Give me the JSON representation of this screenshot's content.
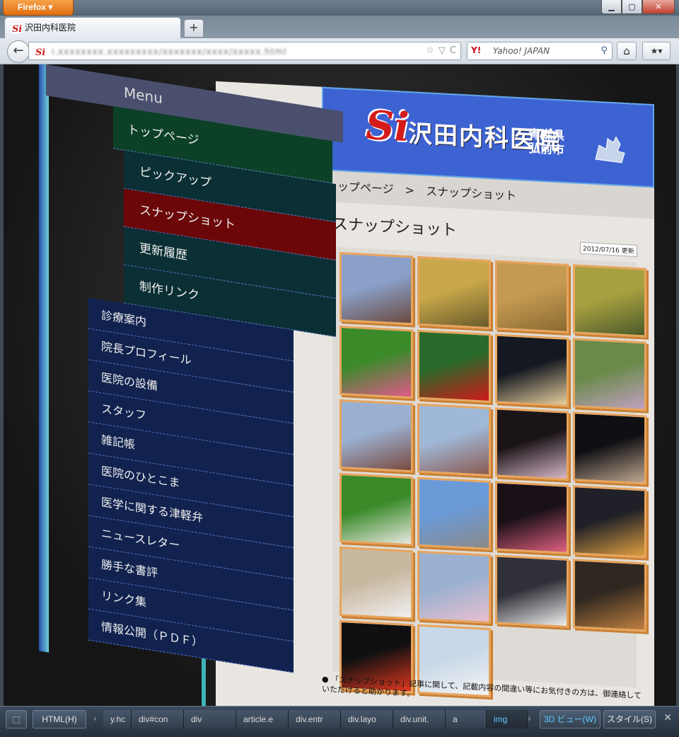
{
  "window": {
    "app_button": "Firefox",
    "controls": {
      "minimize": "▁",
      "maximize": "▢",
      "close": "✕"
    }
  },
  "tab": {
    "title": "沢田内科医院",
    "new_tab": "+"
  },
  "nav": {
    "back": "←",
    "url": "i.xxxxxxxx.xxxxxxxxx/xxxxxxx/xxxx/xxxxx.html",
    "url_icons": {
      "star": "☆",
      "dropdown": "▽",
      "reload": "C"
    },
    "search_engine": "Y!",
    "search_placeholder": "Yahoo! JAPAN",
    "search_icon": "⚲",
    "home": "⌂",
    "bookmarks": "★▾"
  },
  "site": {
    "logo_si": "Si",
    "logo_name": "沢田内科医院",
    "logo_area_line1": "青森県",
    "logo_area_line2": "弘前市",
    "breadcrumb": "トップページ　>　スナップショット",
    "page_title": "スナップショット",
    "updated": "2012/07/16 更新",
    "note": "● 「スナップショット」記事に関して、記載内容の間違い等にお気付きの方は、御連絡していただけると助かります。"
  },
  "menu": {
    "header": "Menu",
    "top": "トップページ",
    "sub_items": [
      {
        "label": "ピックアップ"
      },
      {
        "label": "スナップショット",
        "active": true
      },
      {
        "label": "更新履歴"
      },
      {
        "label": "制作リンク"
      }
    ],
    "items": [
      {
        "label": "診療案内"
      },
      {
        "label": "院長プロフィール"
      },
      {
        "label": "医院の設備"
      },
      {
        "label": "スタッフ"
      },
      {
        "label": "雑記帳"
      },
      {
        "label": "医院のひとこま"
      },
      {
        "label": "医学に関する津軽弁"
      },
      {
        "label": "ニュースレター"
      },
      {
        "label": "勝手な書評"
      },
      {
        "label": "リンク集"
      },
      {
        "label": "情報公開（ＰＤＦ）"
      }
    ]
  },
  "thumbnails": [
    {
      "kind": "building",
      "c1": "#8aa0c8",
      "c2": "#6a4a40"
    },
    {
      "kind": "rice-art",
      "c1": "#c8a84a",
      "c2": "#6a5a2a"
    },
    {
      "kind": "rice-art",
      "c1": "#c49a52",
      "c2": "#8a6a30"
    },
    {
      "kind": "rice-art",
      "c1": "#a8a040",
      "c2": "#4a5a2a"
    },
    {
      "kind": "tulips",
      "c1": "#3a8a2a",
      "c2": "#e05a8a"
    },
    {
      "kind": "tulips",
      "c1": "#2a6a2a",
      "c2": "#d01818"
    },
    {
      "kind": "nebuta",
      "c1": "#141820",
      "c2": "#e8d0a0"
    },
    {
      "kind": "garden",
      "c1": "#6a8a4a",
      "c2": "#c0a0c0"
    },
    {
      "kind": "building",
      "c1": "#9ab0d0",
      "c2": "#7a4a40"
    },
    {
      "kind": "building",
      "c1": "#a0b8d8",
      "c2": "#8a5a50"
    },
    {
      "kind": "night",
      "c1": "#1a1418",
      "c2": "#d8b8c8"
    },
    {
      "kind": "night",
      "c1": "#101014",
      "c2": "#c0a890"
    },
    {
      "kind": "rice-art",
      "c1": "#3a8a2a",
      "c2": "#e8e8e0"
    },
    {
      "kind": "city",
      "c1": "#6a9ad8",
      "c2": "#8a8a8a"
    },
    {
      "kind": "lantern",
      "c1": "#1a1018",
      "c2": "#e06080"
    },
    {
      "kind": "festival",
      "c1": "#202028",
      "c2": "#e0a040"
    },
    {
      "kind": "cat",
      "c1": "#c8b8a0",
      "c2": "#f0f0f0"
    },
    {
      "kind": "castle",
      "c1": "#9ab0d0",
      "c2": "#e8c0d0"
    },
    {
      "kind": "cherry",
      "c1": "#303038",
      "c2": "#f0f0f0"
    },
    {
      "kind": "festival",
      "c1": "#302820",
      "c2": "#c08040"
    },
    {
      "kind": "amaryllis",
      "c1": "#101010",
      "c2": "#e03820"
    },
    {
      "kind": "snow",
      "c1": "#c8d8e8",
      "c2": "#f4f4f4"
    }
  ],
  "devtools": {
    "inspect_icon": "⬚",
    "html_button": "HTML(H)",
    "breadcrumbs": [
      {
        "label": "y.hc"
      },
      {
        "label": "div#con"
      },
      {
        "label": "div"
      },
      {
        "label": "article.e"
      },
      {
        "label": "div.entr"
      },
      {
        "label": "div.layo"
      },
      {
        "label": "div.unit."
      },
      {
        "label": "a"
      },
      {
        "label": "img",
        "selected": true
      }
    ],
    "view3d": "3D ビュー(W)",
    "style": "スタイル(S)",
    "close": "✕"
  }
}
